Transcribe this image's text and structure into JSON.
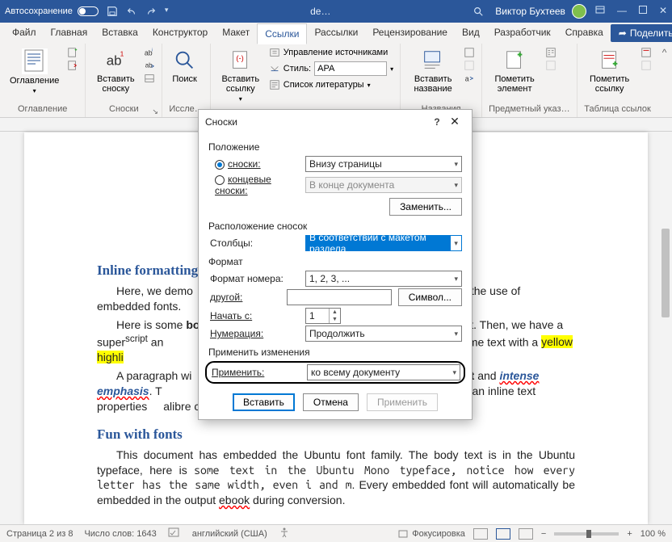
{
  "titlebar": {
    "autosave": "Автосохранение",
    "doc_title": "de…",
    "search_icon": "search",
    "user": "Виктор Бухтеев"
  },
  "tabs": {
    "file": "Файл",
    "home": "Главная",
    "insert": "Вставка",
    "design": "Конструктор",
    "layout": "Макет",
    "references": "Ссылки",
    "mailings": "Рассылки",
    "review": "Рецензирование",
    "view": "Вид",
    "developer": "Разработчик",
    "help": "Справка",
    "share": "Поделиться"
  },
  "ribbon": {
    "toc": {
      "btn": "Оглавление",
      "group": "Оглавление"
    },
    "footnotes": {
      "btn": "Вставить сноску",
      "group": "Сноски"
    },
    "research": {
      "btn": "Поиск",
      "group": "Иссле…"
    },
    "cit": {
      "btn": "Вставить ссылку",
      "manage": "Управление источниками",
      "style_lbl": "Стиль:",
      "style_val": "APA",
      "biblio": "Список литературы"
    },
    "captions": {
      "btn": "Вставить название",
      "group": "Названия"
    },
    "index": {
      "btn": "Пометить элемент",
      "group": "Предметный указ…"
    },
    "toa": {
      "btn": "Пометить ссылку",
      "group": "Таблица ссылок"
    }
  },
  "dialog": {
    "title": "Сноски",
    "s_position": "Положение",
    "opt_footnotes": "сноски:",
    "opt_endnotes": "концевые сноски:",
    "foot_loc": "Внизу страницы",
    "end_loc": "В конце документа",
    "convert": "Заменить...",
    "s_layout": "Расположение сносок",
    "columns_lbl": "Столбцы:",
    "columns_val": "В соответствии с макетом раздела",
    "s_format": "Формат",
    "numfmt_lbl": "Формат номера:",
    "numfmt_val": "1, 2, 3, ...",
    "custom_lbl": "другой:",
    "symbol": "Символ...",
    "start_lbl": "Начать с:",
    "start_val": "1",
    "numbering_lbl": "Нумерация:",
    "numbering_val": "Продолжить",
    "s_apply": "Применить изменения",
    "apply_to_lbl": "Применить:",
    "apply_to_val": "ко всему документу",
    "insert": "Вставить",
    "cancel": "Отмена",
    "apply": "Применить"
  },
  "doc": {
    "h1": "Inline formatting",
    "p1a": "Here, we demo",
    "p1b": " the use of embedded fonts.",
    "p2a": "Here is some ",
    "p2bold": "bo",
    "p2b": "ext. Then, we have a super",
    "p2sup": "script",
    "p2c": " an",
    "p2d": "text. Some text with a ",
    "p2hl": "yellow highli",
    "p3a": "A paragraph wi",
    "p3b": "text",
    "p3c": " and ",
    "p3emph": "intense emphasis",
    "p3d": ". T",
    "p3e": "g rather than inline text properties",
    "p3f": "alibre can handle both with equal ease.",
    "h2": "Fun with fonts",
    "p4": "This document has embedded the Ubuntu font family. The body text is in the Ubuntu typeface, here is ",
    "p4mono": "some text in the Ubuntu Mono typeface, notice how every letter has the same width, even i and m",
    "p4b": ". Every embedded font will automatically be embedded in the output ",
    "p4u": "ebook",
    "p4c": " during conversion."
  },
  "status": {
    "page": "Страница 2 из 8",
    "words": "Число слов: 1643",
    "lang": "английский (США)",
    "focus": "Фокусировка",
    "zoom": "100 %"
  }
}
